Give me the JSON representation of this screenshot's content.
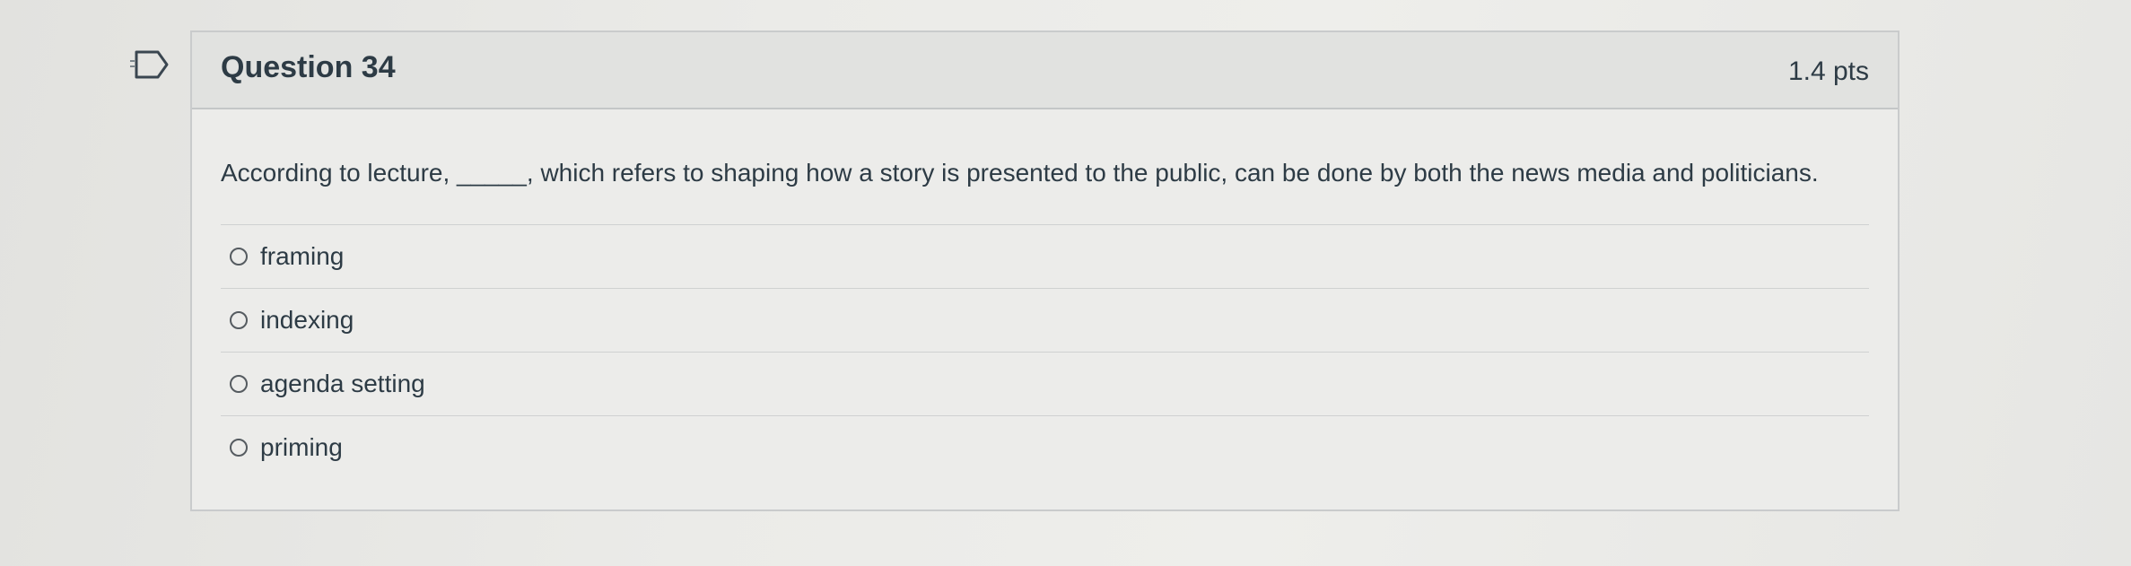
{
  "question": {
    "title": "Question 34",
    "points": "1.4 pts",
    "text": "According to lecture, _____, which refers to shaping how a story is presented to the public, can be done by both the news media and politicians.",
    "flag_icon": "bookmark-flag-icon",
    "answers": [
      {
        "label": "framing",
        "selected": false
      },
      {
        "label": "indexing",
        "selected": false
      },
      {
        "label": "agenda setting",
        "selected": false
      },
      {
        "label": "priming",
        "selected": false
      }
    ]
  },
  "colors": {
    "text": "#2d3b45",
    "border": "#c9cbcc",
    "header_bg": "#e1e2e0"
  }
}
